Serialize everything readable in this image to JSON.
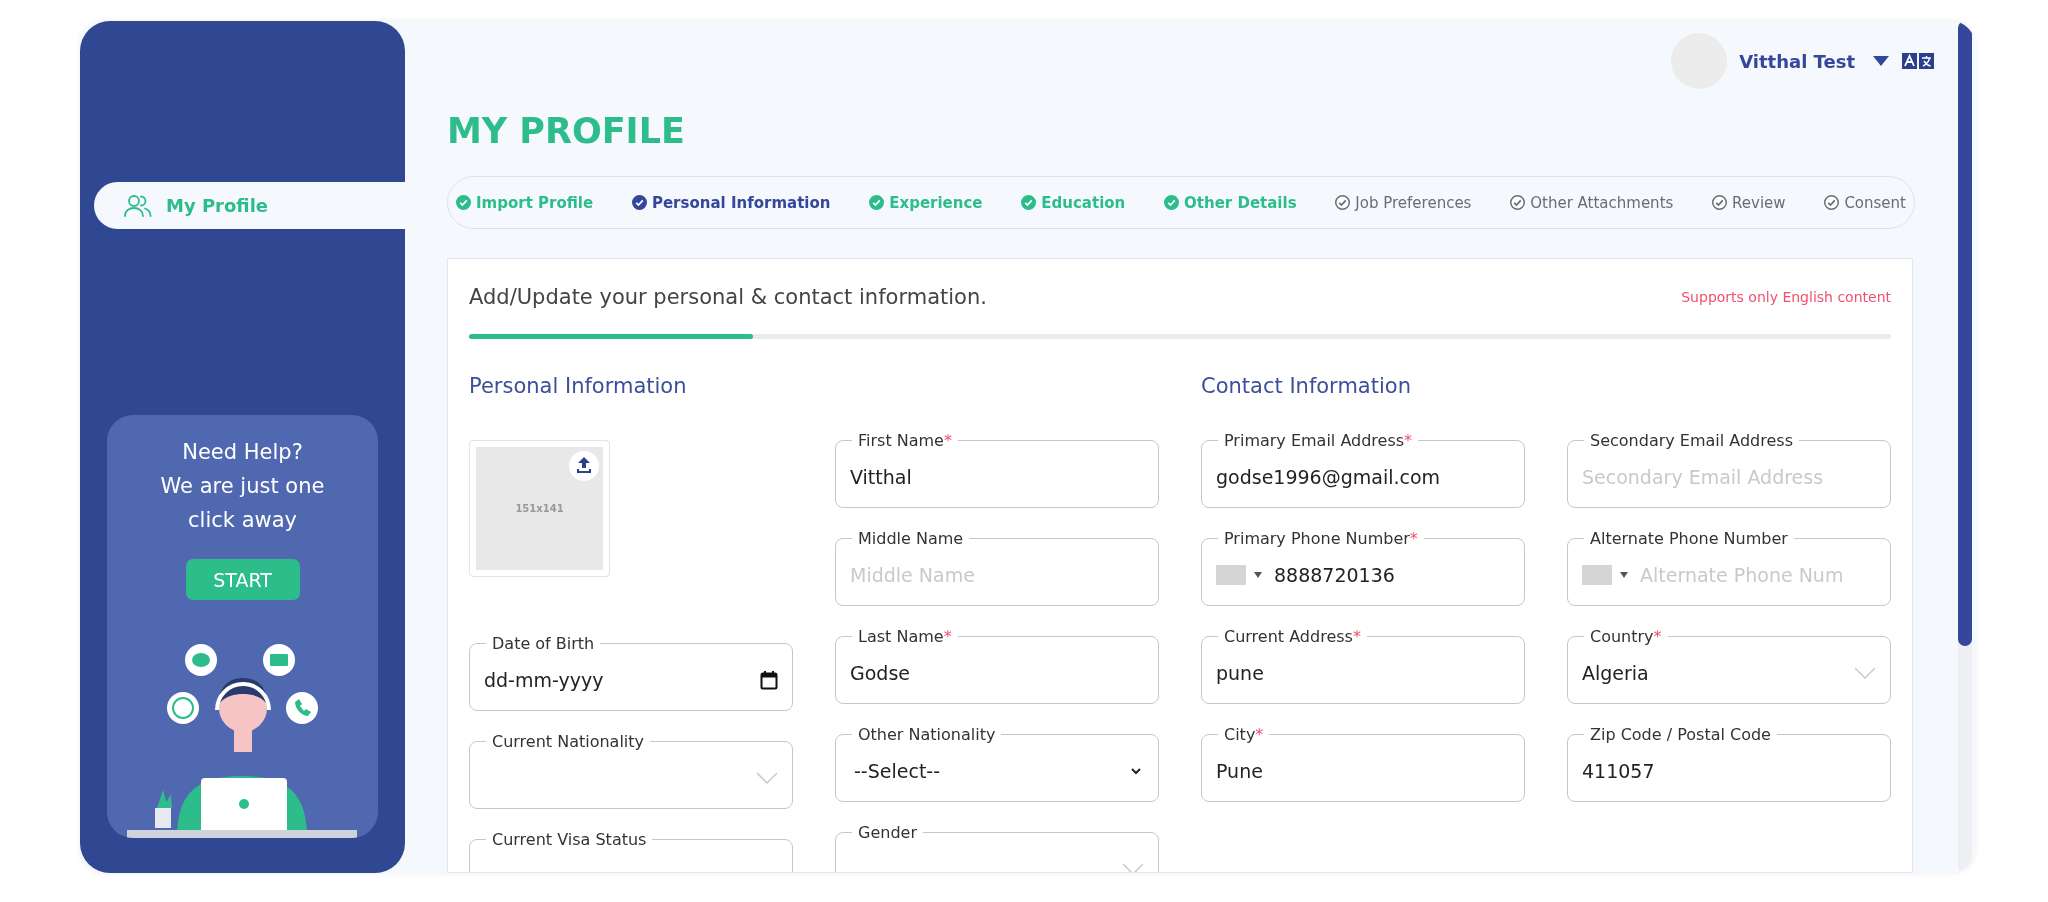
{
  "header": {
    "user_name": "Vitthal Test"
  },
  "sidebar": {
    "items": [
      {
        "label": "My Profile",
        "selected": true
      }
    ],
    "help": {
      "lines": [
        "Need Help?",
        "We are just one",
        "click away"
      ],
      "button": "START"
    }
  },
  "page_title": "MY PROFILE",
  "steps": [
    {
      "label": "Import Profile",
      "done": true,
      "selected": false
    },
    {
      "label": "Personal Information",
      "done": true,
      "selected": true
    },
    {
      "label": "Experience",
      "done": true,
      "selected": false
    },
    {
      "label": "Education",
      "done": true,
      "selected": false
    },
    {
      "label": "Other Details",
      "done": true,
      "selected": false
    },
    {
      "label": "Job Preferences",
      "done": false,
      "selected": false
    },
    {
      "label": "Other Attachments",
      "done": false,
      "selected": false
    },
    {
      "label": "Review",
      "done": false,
      "selected": false
    },
    {
      "label": "Consent",
      "done": false,
      "selected": false
    }
  ],
  "card": {
    "intro": "Add/Update your personal & contact information.",
    "note": "Supports only English content",
    "progress": {
      "level": 0.2
    }
  },
  "sections": [
    {
      "title": "Personal Information",
      "columns": [
        [
          {
            "kind": "photo",
            "caption": "151x141"
          },
          {
            "kind": "date",
            "label": "Date of Birth",
            "value": "dd-mm-yyyy"
          },
          {
            "kind": "combo",
            "label": "Current Nationality"
          },
          {
            "kind": "text",
            "label": "Current Visa Status"
          }
        ],
        [
          {
            "kind": "text",
            "label": "First Name",
            "mark": "*",
            "value": "Vitthal"
          },
          {
            "kind": "text",
            "label": "Middle Name",
            "placeholder": "Middle Name"
          },
          {
            "kind": "text",
            "label": "Last Name",
            "mark": "*",
            "value": "Godse"
          },
          {
            "kind": "select",
            "label": "Other Nationality",
            "value": "--Select--"
          },
          {
            "kind": "combo",
            "label": "Gender"
          }
        ]
      ]
    },
    {
      "title": "Contact Information",
      "columns": [
        [
          {
            "kind": "text",
            "label": "Primary Email Address",
            "mark": "*",
            "value": "godse1996@gmail.com"
          },
          {
            "kind": "phone",
            "label": "Primary Phone Number",
            "mark": "*",
            "value": "8888720136"
          },
          {
            "kind": "text",
            "label": "Current Address",
            "mark": "*",
            "value": "pune"
          },
          {
            "kind": "text",
            "label": "City",
            "mark": "*",
            "value": "Pune"
          }
        ],
        [
          {
            "kind": "text",
            "label": "Secondary Email Address",
            "placeholder": "Secondary Email Address"
          },
          {
            "kind": "phone",
            "label": "Alternate Phone Number",
            "placeholder": "Alternate Phone Num"
          },
          {
            "kind": "combo",
            "label": "Country",
            "mark": "*",
            "value": "Algeria"
          },
          {
            "kind": "text",
            "label": "Zip Code / Postal Code",
            "value": "411057"
          }
        ]
      ]
    }
  ]
}
